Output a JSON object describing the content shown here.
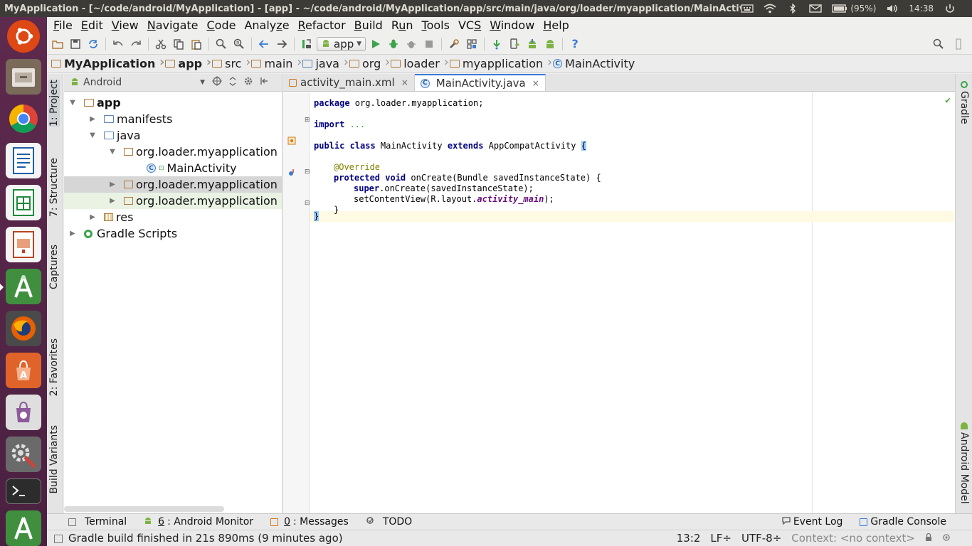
{
  "topbar": {
    "window_title": "MyApplication - [~/code/android/MyApplication] - [app] - ~/code/android/MyApplication/app/src/main/java/org/loader/myapplication/MainActivit",
    "battery": "(95%)",
    "clock": "14:38",
    "icons": [
      "keyboard-icon",
      "wifi-icon",
      "bluetooth-icon",
      "mail-icon",
      "battery-icon",
      "volume-icon",
      "power-icon"
    ]
  },
  "launcher": {
    "apps": [
      "ubuntu-dash",
      "files",
      "chrome",
      "libreoffice-writer",
      "libreoffice-calc",
      "libreoffice-impress",
      "android-studio",
      "firefox",
      "software-center",
      "app-store",
      "system-settings",
      "terminal",
      "android-studio-2"
    ],
    "colors": {
      "dash": "#dd4814",
      "files": "#7a6a5a",
      "chrome": "#4285f4",
      "writer": "#1e5da8",
      "calc": "#1f8a3c",
      "impress": "#b8451f",
      "android": "#3f8f3f",
      "firefox": "#e66000",
      "software": "#e0632a",
      "store": "#8d5a9a",
      "settings": "#c6463c",
      "terminal": "#2c2c2c"
    }
  },
  "menubar": {
    "items": [
      {
        "pre": "",
        "u": "F",
        "post": "ile"
      },
      {
        "pre": "",
        "u": "E",
        "post": "dit"
      },
      {
        "pre": "",
        "u": "V",
        "post": "iew"
      },
      {
        "pre": "",
        "u": "N",
        "post": "avigate"
      },
      {
        "pre": "",
        "u": "C",
        "post": "ode"
      },
      {
        "pre": "Analy",
        "u": "z",
        "post": "e"
      },
      {
        "pre": "",
        "u": "R",
        "post": "efactor"
      },
      {
        "pre": "",
        "u": "B",
        "post": "uild"
      },
      {
        "pre": "R",
        "u": "u",
        "post": "n"
      },
      {
        "pre": "",
        "u": "T",
        "post": "ools"
      },
      {
        "pre": "VC",
        "u": "S",
        "post": ""
      },
      {
        "pre": "",
        "u": "W",
        "post": "indow"
      },
      {
        "pre": "",
        "u": "H",
        "post": "elp"
      }
    ]
  },
  "toolbar": {
    "run_config": "app",
    "help": "?"
  },
  "breadcrumbs": [
    "MyApplication",
    "app",
    "src",
    "main",
    "java",
    "org",
    "loader",
    "myapplication",
    "MainActivity"
  ],
  "left_tabs": [
    "1: Project",
    "7: Structure",
    "Captures",
    "2: Favorites",
    "Build Variants"
  ],
  "right_tabs": [
    "Gradle",
    "Android Model"
  ],
  "project": {
    "view": "Android",
    "tree": [
      {
        "label": "app",
        "arrow": "▼",
        "indent": 0
      },
      {
        "label": "manifests",
        "arrow": "▶",
        "indent": 1
      },
      {
        "label": "java",
        "arrow": "▼",
        "indent": 1
      },
      {
        "label": "org.loader.myapplication",
        "arrow": "▼",
        "indent": 2
      },
      {
        "label": "MainActivity",
        "arrow": "",
        "indent": 3
      },
      {
        "label": "org.loader.myapplication",
        "arrow": "▶",
        "indent": 2
      },
      {
        "label": "org.loader.myapplication",
        "arrow": "▶",
        "indent": 2
      },
      {
        "label": "res",
        "arrow": "▶",
        "indent": 1
      },
      {
        "label": "Gradle Scripts",
        "arrow": "▶",
        "indent": 0
      }
    ]
  },
  "editor": {
    "tabs": [
      {
        "label": "activity_main.xml",
        "close": "×"
      },
      {
        "label": "MainActivity.java",
        "close": "×"
      }
    ],
    "code": {
      "l1_kw": "package",
      "l1_rest": " org.loader.myapplication;",
      "l2_kw": "import",
      "l2_rest": " ...",
      "l3_kw1": "public class",
      "l3_mid": " MainActivity ",
      "l3_kw2": "extends",
      "l3_rest": " AppCompatActivity ",
      "l3_brace": "{",
      "l4_ann": "@Override",
      "l5_kw": "protected void",
      "l5_rest": " onCreate(Bundle savedInstanceState) {",
      "l6_kw": "super",
      "l6_rest": ".onCreate(savedInstanceState);",
      "l7_pre": "setContentView(R.layout.",
      "l7_it": "activity_main",
      "l7_post": ");",
      "l8": "}",
      "l9": "}"
    },
    "check": "✔"
  },
  "bottom_tools": {
    "left": [
      {
        "pre": "",
        "u": "",
        "post": "Terminal"
      },
      {
        "pre": "",
        "u": "6",
        "post": ": Android Monitor"
      },
      {
        "pre": "",
        "u": "0",
        "post": ": Messages"
      },
      {
        "pre": "",
        "u": "",
        "post": "TODO"
      }
    ],
    "right": [
      "Event Log",
      "Gradle Console"
    ]
  },
  "status": {
    "message": "Gradle build finished in 21s 890ms (9 minutes ago)",
    "position": "13:2",
    "line_sep": "LF÷",
    "encoding": "UTF-8÷",
    "context": "Context: <no context>"
  }
}
